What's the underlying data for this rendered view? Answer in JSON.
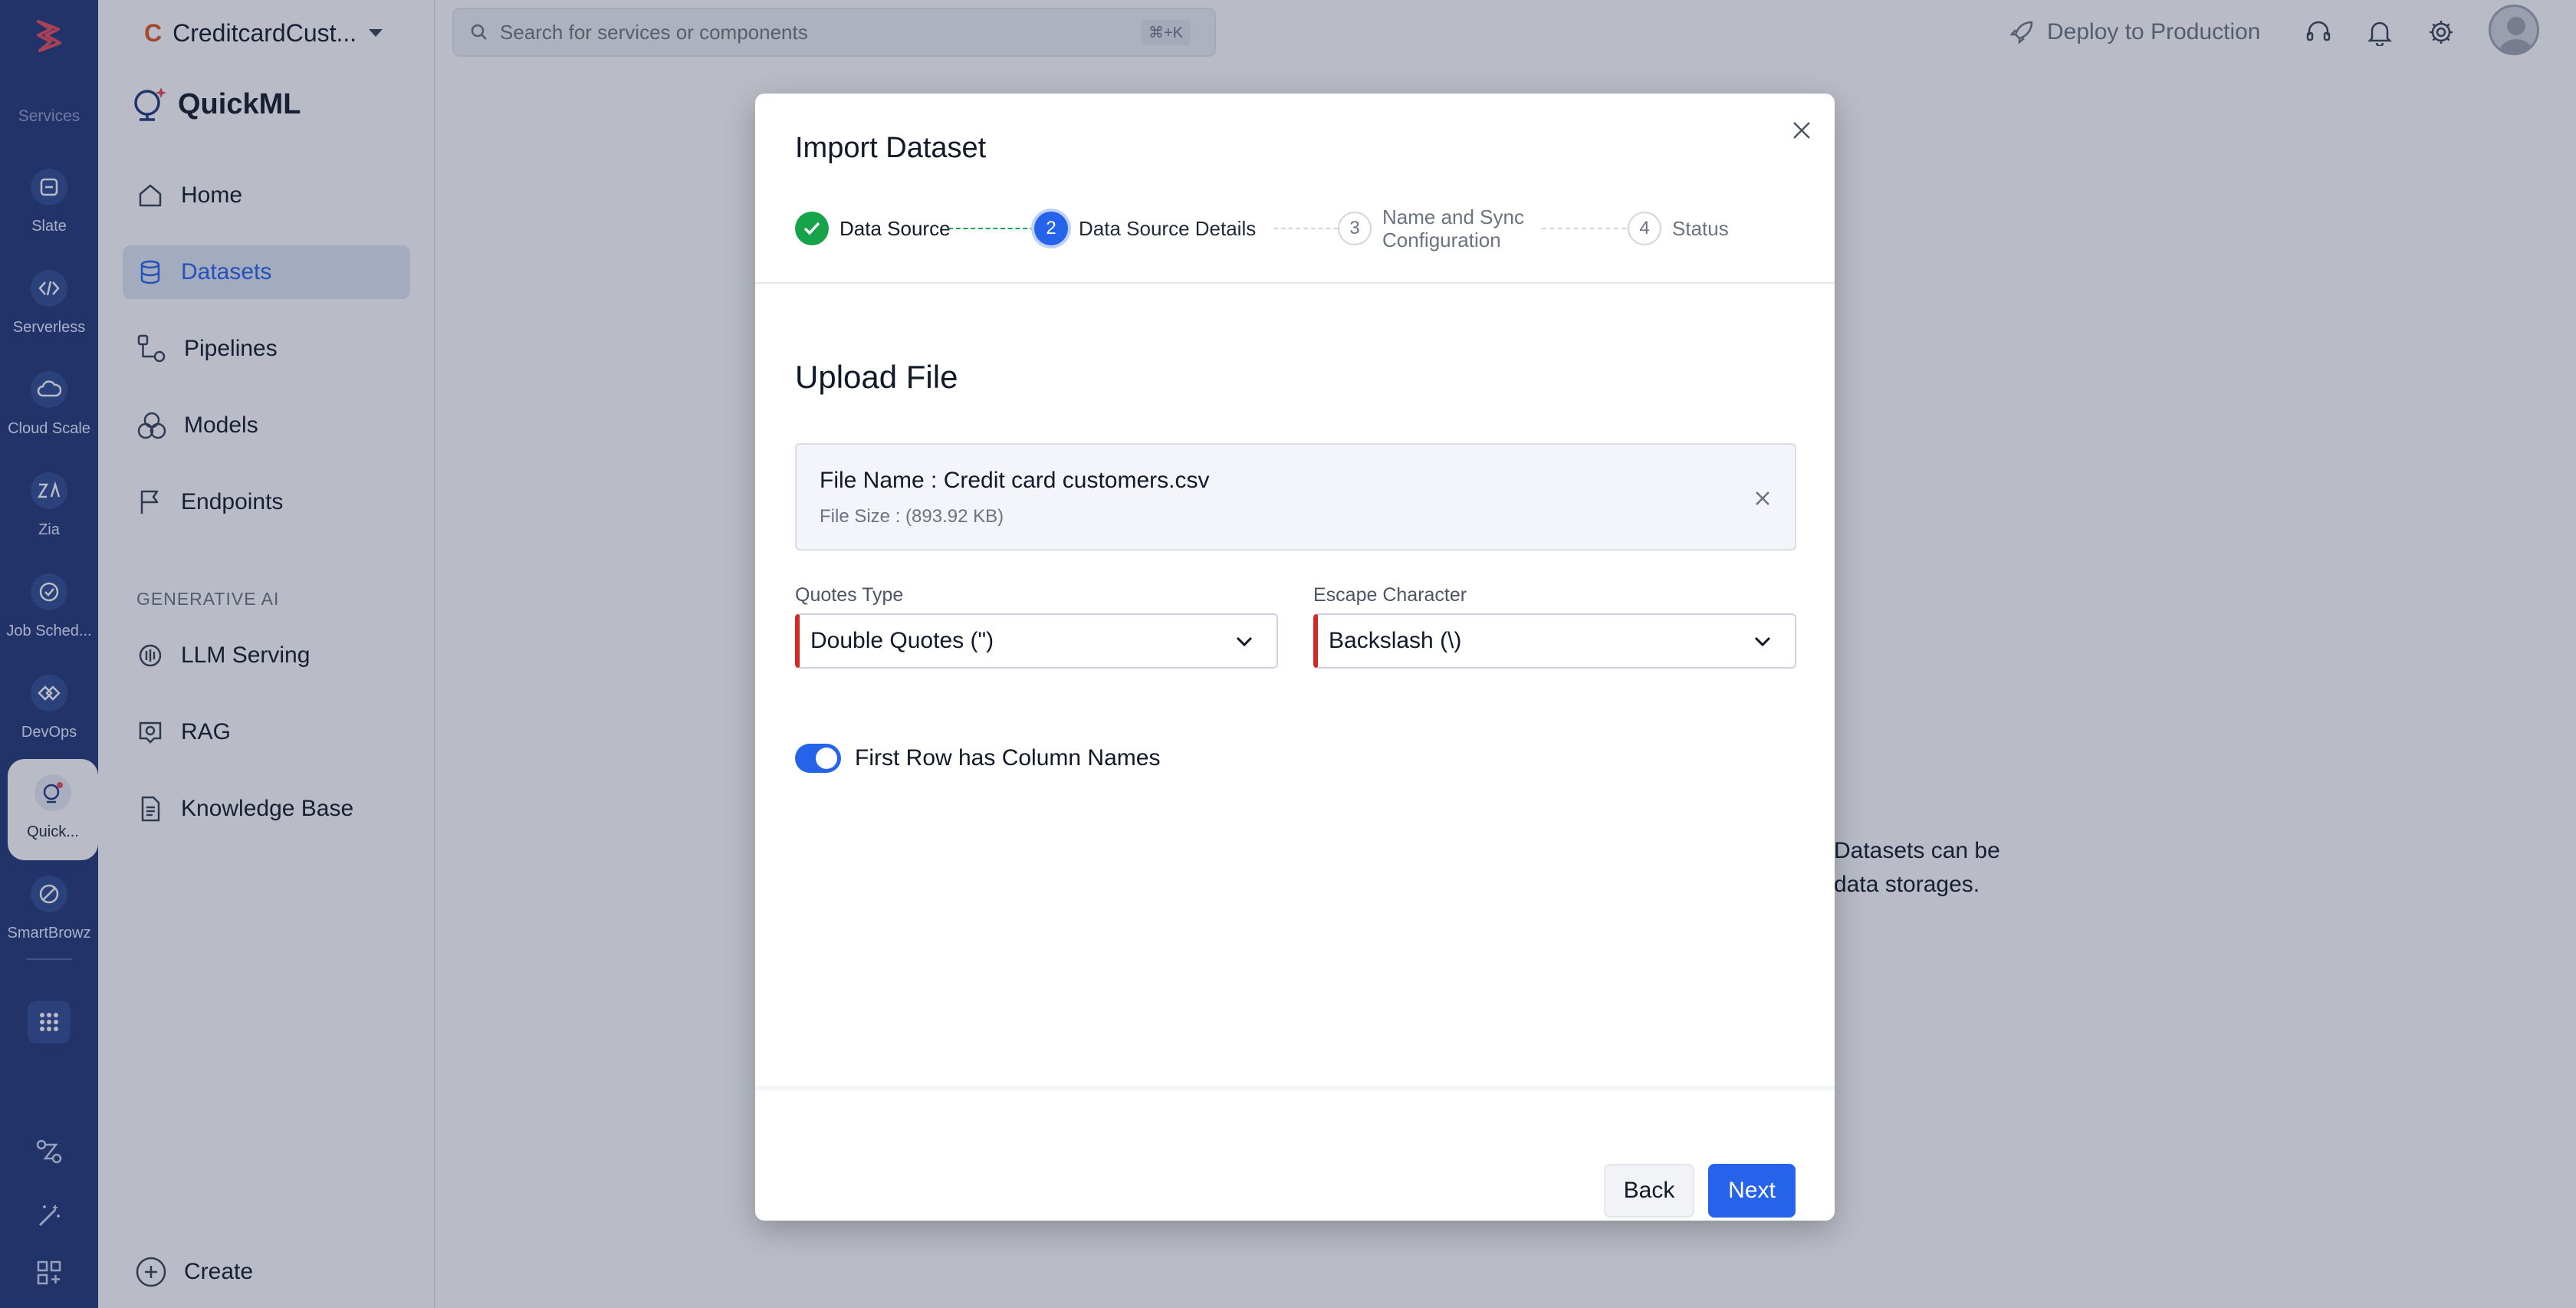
{
  "rail": {
    "section": "Services",
    "items": [
      {
        "label": "Slate",
        "icon": "slate-icon"
      },
      {
        "label": "Serverless",
        "icon": "code-icon"
      },
      {
        "label": "Cloud Scale",
        "icon": "cloud-icon"
      },
      {
        "label": "Zia",
        "icon": "zia-icon"
      },
      {
        "label": "Job Sched...",
        "icon": "job-scheduler-icon"
      },
      {
        "label": "DevOps",
        "icon": "devops-icon"
      },
      {
        "label": "Quick...",
        "icon": "quickml-icon"
      },
      {
        "label": "SmartBrowz",
        "icon": "smartbrowz-icon"
      }
    ]
  },
  "project": {
    "badge": "C",
    "name": "CreditcardCust..."
  },
  "product": {
    "name": "QuickML"
  },
  "nav": {
    "items": [
      "Home",
      "Datasets",
      "Pipelines",
      "Models",
      "Endpoints"
    ],
    "section": "GENERATIVE AI",
    "genai_items": [
      "LLM Serving",
      "RAG",
      "Knowledge Base"
    ],
    "create": "Create"
  },
  "topbar": {
    "search_placeholder": "Search for services or components",
    "shortcut": "⌘+K",
    "deploy": "Deploy to Production"
  },
  "background": {
    "line1": "Datasets can be",
    "line2": "data storages."
  },
  "modal": {
    "title": "Import Dataset",
    "steps": [
      {
        "number": "1",
        "label": "Data Source",
        "state": "done"
      },
      {
        "number": "2",
        "label": "Data Source Details",
        "state": "current"
      },
      {
        "number": "3",
        "label": "Name and Sync Configuration",
        "state": "todo"
      },
      {
        "number": "4",
        "label": "Status",
        "state": "todo"
      }
    ],
    "section_title": "Upload File",
    "file": {
      "name": "File Name : Credit card customers.csv",
      "size": "File Size : (893.92 KB)"
    },
    "quotes": {
      "label": "Quotes Type",
      "value": "Double Quotes (\")"
    },
    "escape": {
      "label": "Escape Character",
      "value": "Backslash (\\)"
    },
    "toggle": {
      "label": "First Row has Column Names",
      "on": true
    },
    "buttons": {
      "back": "Back",
      "next": "Next"
    }
  },
  "colors": {
    "accent": "#2563eb",
    "rail": "#1f3577",
    "success": "#16a34a",
    "required": "#dc2626"
  }
}
